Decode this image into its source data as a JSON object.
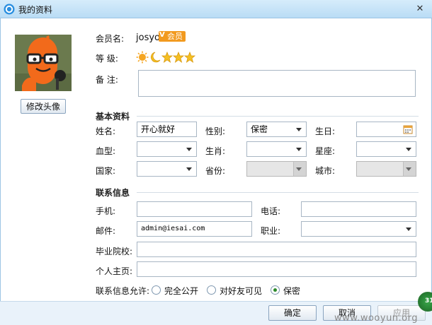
{
  "window": {
    "title": "我的资料",
    "close_glyph": "✕"
  },
  "profile": {
    "edit_avatar_button": "修改头像",
    "member_name_label": "会员名:",
    "member_name_value": "josyo",
    "member_badge": "会员",
    "level_label": "等  级:",
    "remark_label": "备  注:",
    "remark_value": ""
  },
  "basic": {
    "heading": "基本资料",
    "name_label": "姓名:",
    "name_value": "开心就好",
    "gender_label": "性别:",
    "gender_value": "保密",
    "birthday_label": "生日:",
    "birthday_value": "",
    "blood_label": "血型:",
    "blood_value": "",
    "zodiac_label": "生肖:",
    "zodiac_value": "",
    "constellation_label": "星座:",
    "constellation_value": "",
    "country_label": "国家:",
    "country_value": "",
    "province_label": "省份:",
    "province_value": "",
    "city_label": "城市:",
    "city_value": ""
  },
  "contact": {
    "heading": "联系信息",
    "mobile_label": "手机:",
    "mobile_value": "",
    "phone_label": "电话:",
    "phone_value": "",
    "email_label": "邮件:",
    "email_value": "admin@iesai.com",
    "job_label": "职业:",
    "job_value": "",
    "school_label": "毕业院校:",
    "school_value": "",
    "homepage_label": "个人主页:",
    "homepage_value": "",
    "visibility_label": "联系信息允许:",
    "visibility_options": [
      "完全公开",
      "对好友可见",
      "保密"
    ],
    "visibility_selected": "保密"
  },
  "footer": {
    "ok": "确定",
    "cancel": "取消",
    "apply": "应用",
    "watermark": "www.wooyun.org",
    "badge": "31"
  },
  "colors": {
    "avatar_bg": "#6b7a4e",
    "avatar_orange": "#f26a1b",
    "badge_orange": "#f29a1f",
    "sun": "#f5a623"
  }
}
